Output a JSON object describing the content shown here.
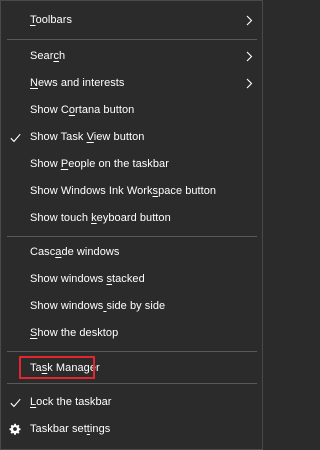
{
  "menu": {
    "items": [
      {
        "label": "Toolbars",
        "accel_index": 0
      },
      {
        "label": "Search",
        "accel_index": 4
      },
      {
        "label": "News and interests",
        "accel_index": 0
      },
      {
        "label": "Show Cortana button",
        "accel_index": 6
      },
      {
        "label": "Show Task View button",
        "accel_index": 10
      },
      {
        "label": "Show People on the taskbar",
        "accel_index": 5
      },
      {
        "label": "Show Windows Ink Workspace button",
        "accel_index": 21
      },
      {
        "label": "Show touch keyboard button",
        "accel_index": 11
      },
      {
        "label": "Cascade windows",
        "accel_index": 4
      },
      {
        "label": "Show windows stacked",
        "accel_index": 13
      },
      {
        "label": "Show windows side by side",
        "accel_index": 12
      },
      {
        "label": "Show the desktop",
        "accel_index": 0
      },
      {
        "label": "Task Manager",
        "accel_index": 2
      },
      {
        "label": "Lock the taskbar",
        "accel_index": 0
      },
      {
        "label": "Taskbar settings",
        "accel_index": 11
      }
    ]
  },
  "colors": {
    "background": "#2b2b2b",
    "text": "#ffffff",
    "separator": "#5a5a5a",
    "highlight_border": "#e0262e"
  },
  "icons": {
    "submenu": "chevron-right-icon",
    "checked": "checkmark-icon",
    "settings": "gear-icon"
  }
}
